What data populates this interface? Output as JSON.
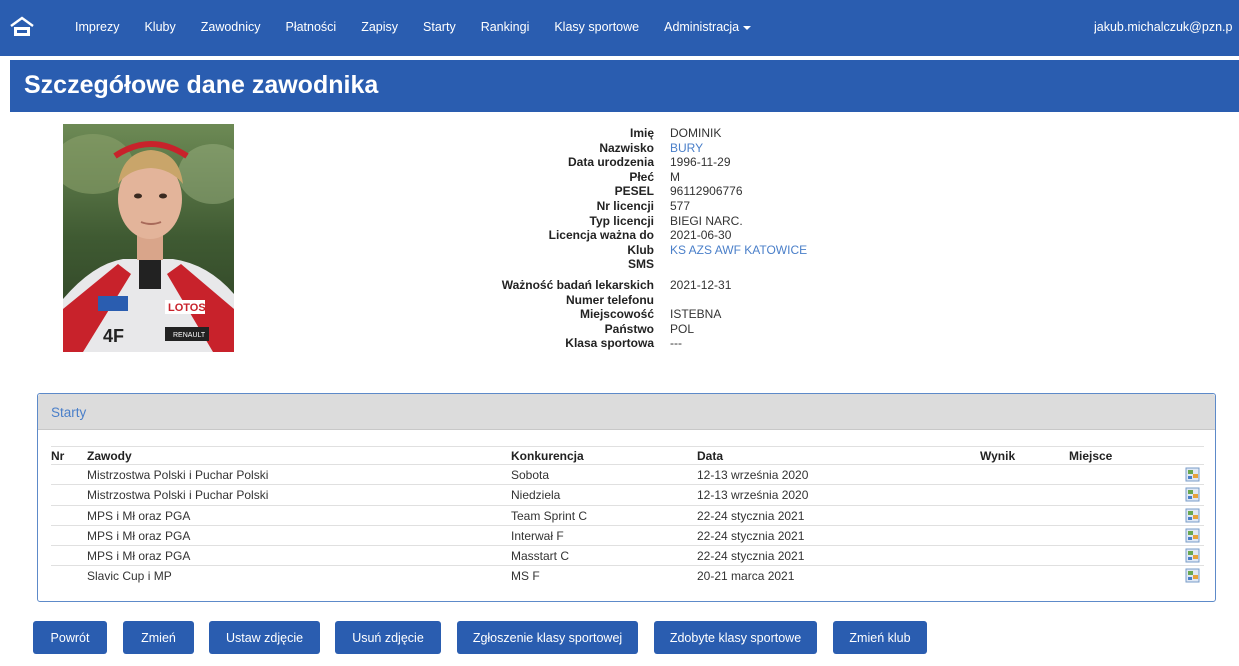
{
  "nav": {
    "items": [
      "Imprezy",
      "Kluby",
      "Zawodnicy",
      "Płatności",
      "Zapisy",
      "Starty",
      "Rankingi",
      "Klasy sportowe",
      "Administracja"
    ],
    "user": "jakub.michalczuk@pzn.p"
  },
  "page": {
    "title": "Szczegółowe dane zawodnika"
  },
  "details": {
    "rows": [
      {
        "label": "Imię",
        "value": "DOMINIK"
      },
      {
        "label": "Nazwisko",
        "value": "BURY"
      },
      {
        "label": "Data urodzenia",
        "value": "1996-11-29"
      },
      {
        "label": "Płeć",
        "value": "M"
      },
      {
        "label": "PESEL",
        "value": "96112906776"
      },
      {
        "label": "Nr licencji",
        "value": "577"
      },
      {
        "label": "Typ licencji",
        "value": "BIEGI NARC."
      },
      {
        "label": "Licencja ważna do",
        "value": "2021-06-30"
      },
      {
        "label": "Klub",
        "value": "KS AZS AWF KATOWICE"
      },
      {
        "label": "SMS",
        "value": ""
      },
      {
        "label": "Ważność badań lekarskich",
        "value": "2021-12-31"
      },
      {
        "label": "Numer telefonu",
        "value": ""
      },
      {
        "label": "Miejscowość",
        "value": "ISTEBNA"
      },
      {
        "label": "Państwo",
        "value": "POL"
      },
      {
        "label": "Klasa sportowa",
        "value": "---"
      }
    ]
  },
  "starty": {
    "title": "Starty",
    "columns": {
      "nr": "Nr",
      "zawody": "Zawody",
      "konkurencja": "Konkurencja",
      "data": "Data",
      "wynik": "Wynik",
      "miejsce": "Miejsce"
    },
    "rows": [
      {
        "zawody": "Mistrzostwa Polski i Puchar Polski",
        "konkurencja": "Sobota",
        "data": "12-13 września 2020"
      },
      {
        "zawody": "Mistrzostwa Polski i Puchar Polski",
        "konkurencja": "Niedziela",
        "data": "12-13 września 2020"
      },
      {
        "zawody": "MPS i Mł oraz PGA",
        "konkurencja": "Team Sprint C",
        "data": "22-24 stycznia 2021"
      },
      {
        "zawody": "MPS i Mł oraz PGA",
        "konkurencja": "Interwał F",
        "data": "22-24 stycznia 2021"
      },
      {
        "zawody": "MPS i Mł oraz PGA",
        "konkurencja": "Masstart C",
        "data": "22-24 stycznia 2021"
      },
      {
        "zawody": "Slavic Cup i MP",
        "konkurencja": "MS F",
        "data": "20-21 marca 2021"
      }
    ]
  },
  "buttons": [
    "Powrót",
    "Zmień",
    "Ustaw zdjęcie",
    "Usuń zdjęcie",
    "Zgłoszenie klasy sportowej",
    "Zdobyte klasy sportowe",
    "Zmień klub"
  ],
  "colors": {
    "primary": "#2a5db0",
    "link": "#4a7fc9",
    "panel_head": "#dcdcdc"
  }
}
